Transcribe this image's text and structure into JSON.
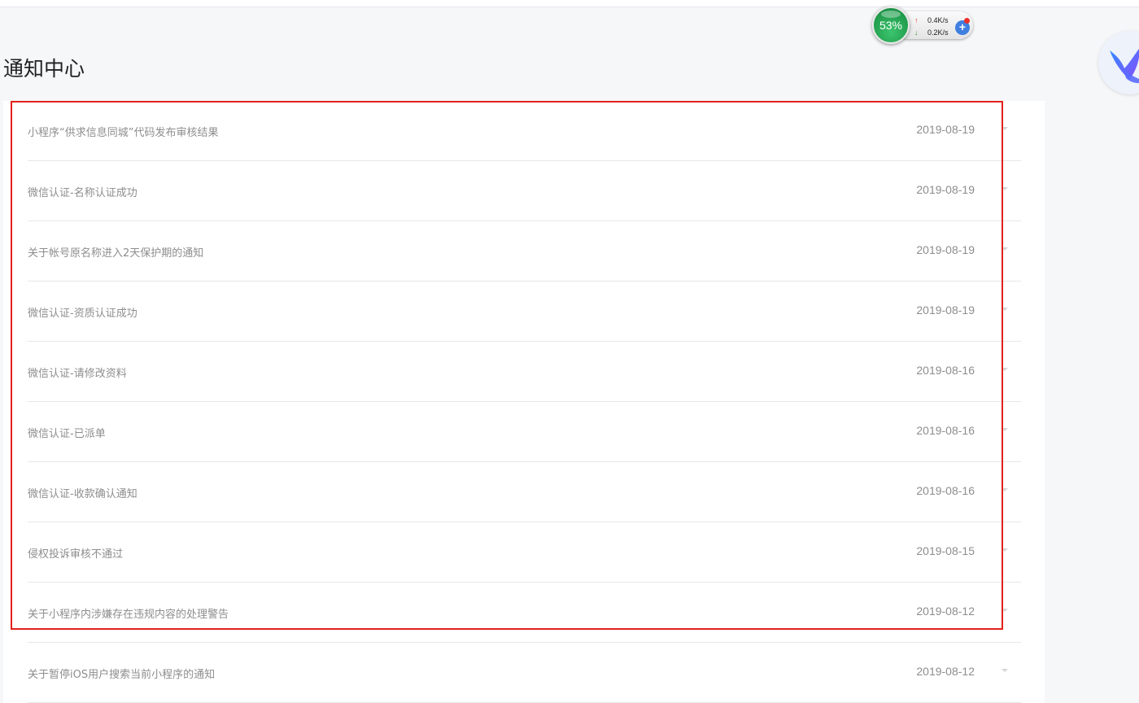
{
  "page": {
    "title": "通知中心"
  },
  "speed_widget": {
    "percent": "53%",
    "upload": "0.4K/s",
    "download": "0.2K/s"
  },
  "notifications": [
    {
      "title": "小程序“供求信息同城”代码发布审核结果",
      "date": "2019-08-19"
    },
    {
      "title": "微信认证-名称认证成功",
      "date": "2019-08-19"
    },
    {
      "title": "关于帐号原名称进入2天保护期的通知",
      "date": "2019-08-19"
    },
    {
      "title": "微信认证-资质认证成功",
      "date": "2019-08-19"
    },
    {
      "title": "微信认证-请修改资料",
      "date": "2019-08-16"
    },
    {
      "title": "微信认证-已派单",
      "date": "2019-08-16"
    },
    {
      "title": "微信认证-收款确认通知",
      "date": "2019-08-16"
    },
    {
      "title": "侵权投诉审核不通过",
      "date": "2019-08-15"
    },
    {
      "title": "关于小程序内涉嫌存在违规内容的处理警告",
      "date": "2019-08-12"
    },
    {
      "title": "关于暂停iOS用户搜索当前小程序的通知",
      "date": "2019-08-12"
    }
  ],
  "colors": {
    "highlight": "#e3211c",
    "text_muted": "#8d8d8d",
    "speed_ball": "#1f9a4b"
  },
  "icons": {
    "expand": "chevron-down-icon",
    "logo": "bird-logo-icon",
    "plus": "plus-icon"
  }
}
